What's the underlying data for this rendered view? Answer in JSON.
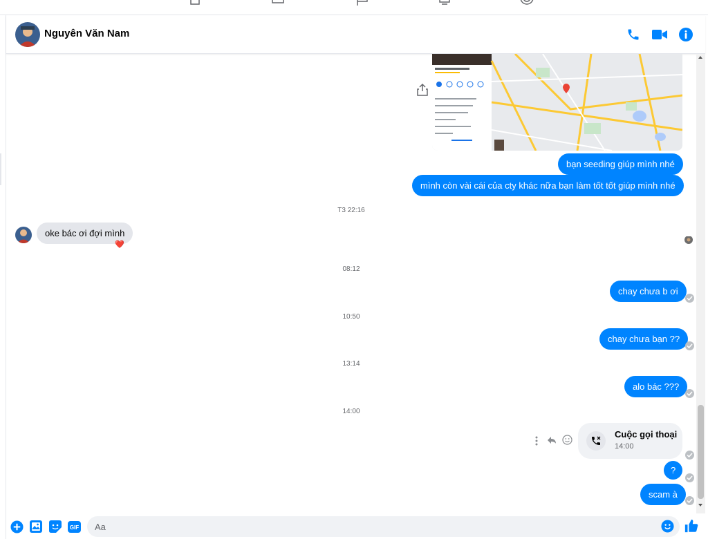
{
  "header": {
    "contact_name": "Nguyên Văn Nam"
  },
  "messages": {
    "out_1": "bạn seeding giúp mình nhé",
    "out_2": "mình còn vài cái của cty khác nữa bạn làm tốt tốt giúp mình nhé",
    "ts_1": "T3 22:16",
    "in_1": "oke bác ơi đợi mình",
    "in_1_reaction": "❤️",
    "ts_2": "08:12",
    "out_3": "chay chưa b ơi",
    "ts_3": "10:50",
    "out_4": "chay chưa bạn ??",
    "ts_4": "13:14",
    "out_5": "alo bác ???",
    "ts_5": "14:00",
    "call_title": "Cuộc gọi thoại",
    "call_time": "14:00",
    "out_6": "?",
    "out_7": "scam à"
  },
  "composer": {
    "placeholder": "Aa"
  },
  "colors": {
    "accent": "#0084ff",
    "bubble_in": "#e4e6eb",
    "timestamp": "#65676b"
  },
  "icons": [
    "phone-icon",
    "video-icon",
    "info-icon",
    "share-icon",
    "plus-icon",
    "image-icon",
    "sticker-icon",
    "gif-icon",
    "emoji-icon",
    "like-icon",
    "missed-call-icon",
    "more-icon",
    "reply-icon",
    "react-icon"
  ]
}
